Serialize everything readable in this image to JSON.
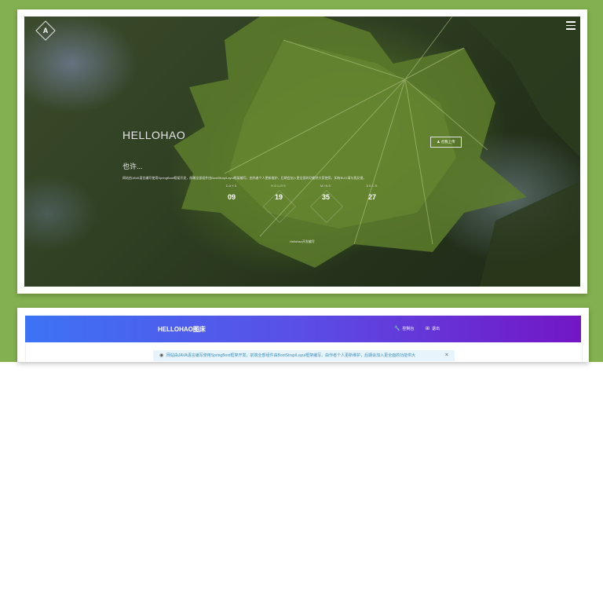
{
  "hero": {
    "title": "HELLOHAO",
    "subtitle": "也许...",
    "description": "网站由JAVA语言编写使用SpringBoot框架开发，前端全部组件由BootStrap/Layui框架编写。由作者个人更新维护，后期会加入更全面的功能供大家使用，如有BUG请与我反馈。",
    "upload_button": "点我上传",
    "footer": "Hellohao开发编写",
    "countdown": [
      {
        "label": "DAYS",
        "value": "09"
      },
      {
        "label": "HOURS",
        "value": "19"
      },
      {
        "label": "MINS",
        "value": "35"
      },
      {
        "label": "SECS",
        "value": "27"
      }
    ]
  },
  "navbar": {
    "brand": "HELLOHAO图床",
    "console": "控制台",
    "login": "退出",
    "console_icon": "wrench-icon",
    "login_icon": "logout-icon"
  },
  "alert": {
    "text": "网站由JAVA语言编写使用SpringBoot框架开发，前端全部组件由BootStrap/Layui框架编写。由作者个人更新维护，后期会加入更全面的功能供大",
    "icon": "eye-icon",
    "close": "×"
  },
  "colors": {
    "background": "#83b14f",
    "nav_start": "#3d73f5",
    "nav_end": "#7316c5",
    "alert_bg": "#e8f4fb"
  }
}
